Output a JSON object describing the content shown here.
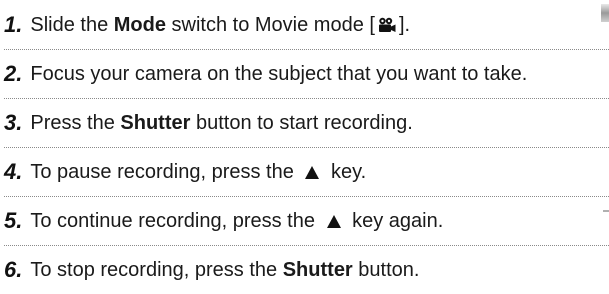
{
  "steps": [
    {
      "num": "1.",
      "text": [
        {
          "t": "Slide the "
        },
        {
          "t": "Mode",
          "b": true
        },
        {
          "t": " switch to Movie mode ["
        },
        {
          "icon": "movie-camera-icon"
        },
        {
          "t": "]."
        }
      ]
    },
    {
      "num": "2.",
      "text": [
        {
          "t": "Focus your camera on the subject that you want to take."
        }
      ]
    },
    {
      "num": "3.",
      "text": [
        {
          "t": "Press the "
        },
        {
          "t": "Shutter",
          "b": true
        },
        {
          "t": " button to start recording."
        }
      ]
    },
    {
      "num": "4.",
      "text": [
        {
          "t": "To pause recording, press the "
        },
        {
          "icon": "up-triangle-icon"
        },
        {
          "t": " key."
        }
      ]
    },
    {
      "num": "5.",
      "text": [
        {
          "t": "To continue recording, press the "
        },
        {
          "icon": "up-triangle-icon"
        },
        {
          "t": " key again."
        }
      ]
    },
    {
      "num": "6.",
      "text": [
        {
          "t": "To stop recording, press the "
        },
        {
          "t": "Shutter",
          "b": true
        },
        {
          "t": " button."
        }
      ]
    }
  ]
}
